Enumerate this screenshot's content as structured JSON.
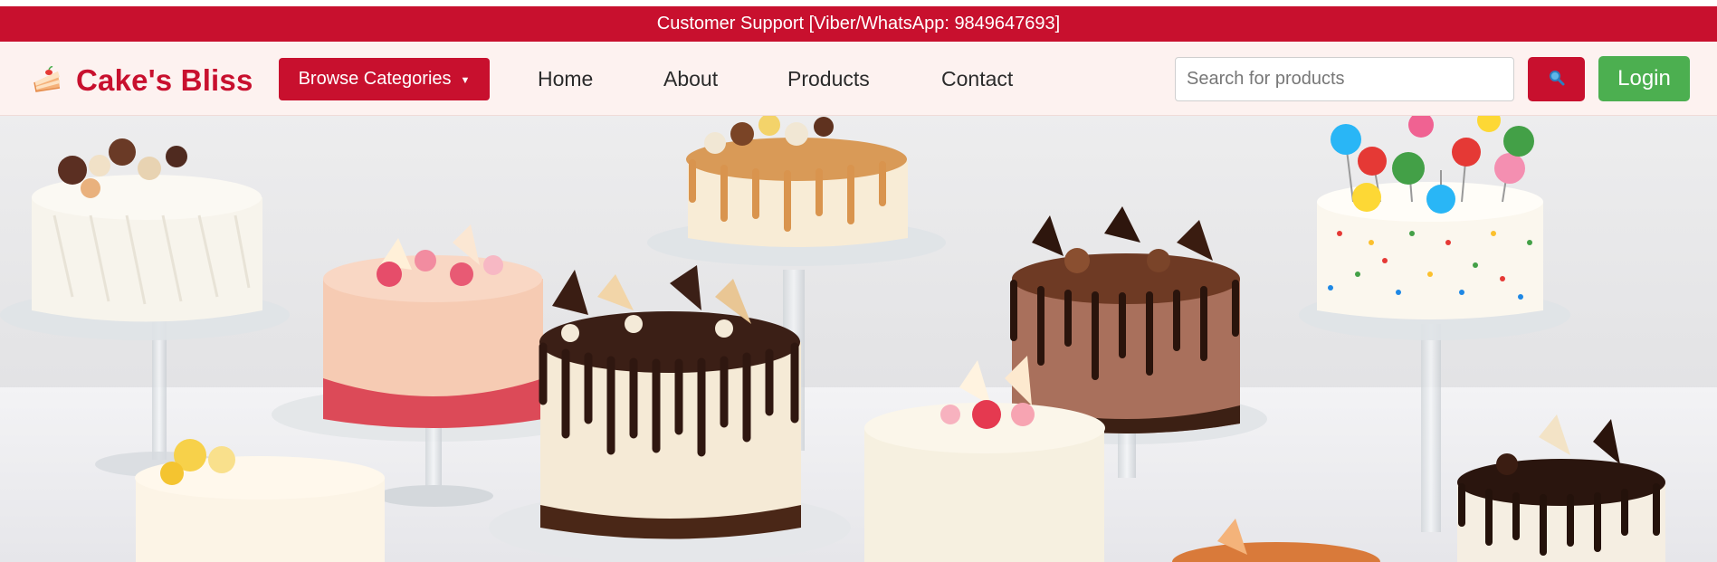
{
  "support": {
    "text": "Customer Support [Viber/WhatsApp: 9849647693]"
  },
  "brand": {
    "name": "Cake's Bliss",
    "icon": "cake-slice-icon"
  },
  "nav": {
    "browse_label": "Browse Categories",
    "browse_caret": "▼",
    "links": [
      "Home",
      "About",
      "Products",
      "Contact"
    ]
  },
  "search": {
    "placeholder": "Search for products",
    "value": "",
    "button_icon": "magnifier-icon"
  },
  "auth": {
    "login_label": "Login"
  },
  "colors": {
    "primary": "#c8102e",
    "navbar_bg": "#fdf2f0",
    "login": "#4caf50"
  },
  "hero": {
    "image": "hero-cakes-image"
  }
}
